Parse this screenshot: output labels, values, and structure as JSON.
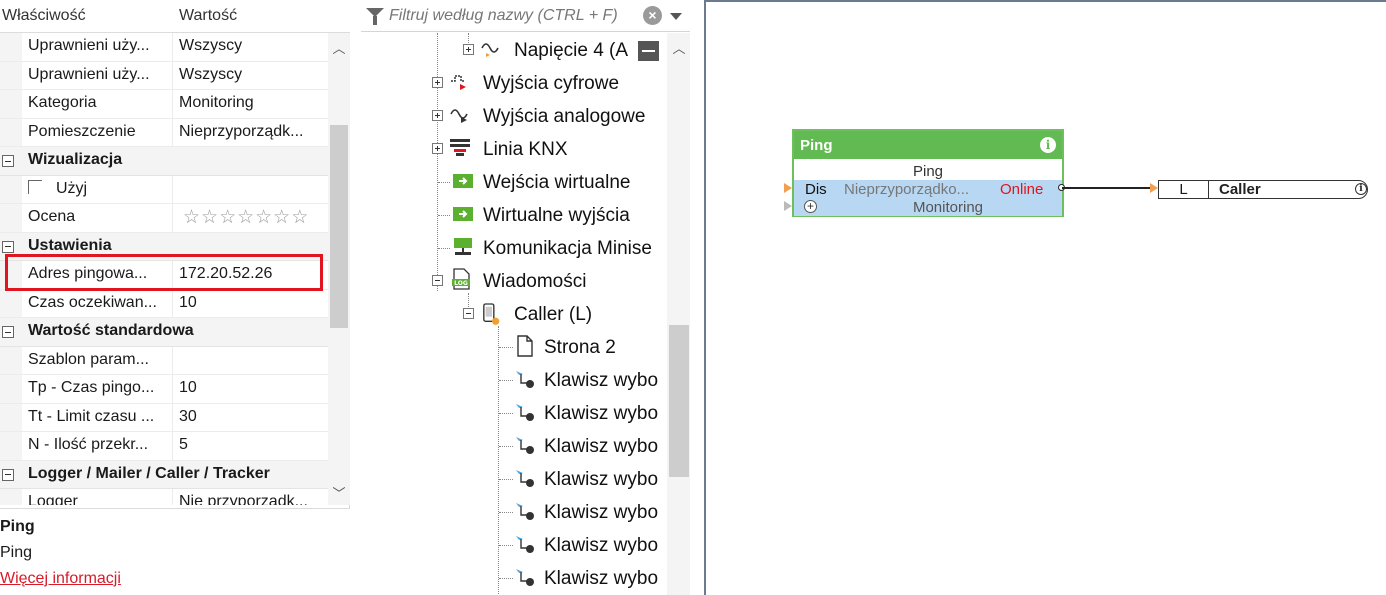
{
  "properties": {
    "header": {
      "col_name": "Właściwość",
      "col_value": "Wartość"
    },
    "rows": [
      {
        "name": "Uprawnieni uży...",
        "value": "Wszyscy"
      },
      {
        "name": "Uprawnieni uży...",
        "value": "Wszyscy"
      },
      {
        "name": "Kategoria",
        "value": "Monitoring"
      },
      {
        "name": "Pomieszczenie",
        "value": "Nieprzyporządk..."
      }
    ],
    "group_visualization": "Wizualizacja",
    "use_label": "Użyj",
    "rating_label": "Ocena",
    "rating_stars": "☆☆☆☆☆☆☆",
    "group_settings": "Ustawienia",
    "settings_rows": [
      {
        "name": "Adres pingowa...",
        "value": "172.20.52.26"
      },
      {
        "name": "Czas oczekiwan...",
        "value": "10"
      }
    ],
    "group_default": "Wartość standardowa",
    "default_rows": [
      {
        "name": "Szablon param...",
        "value": ""
      },
      {
        "name": "Tp - Czas pingo...",
        "value": "10"
      },
      {
        "name": "Tt - Limit czasu ...",
        "value": "30"
      },
      {
        "name": "N - Ilość przekr...",
        "value": "5"
      }
    ],
    "group_logger": "Logger / Mailer / Caller / Tracker",
    "logger_row": {
      "name": "Logger",
      "value": "Nie przyporządk..."
    },
    "info": {
      "title": "Ping",
      "subtitle": "Ping",
      "link": "Więcej informacji"
    }
  },
  "tree": {
    "filter_placeholder": "Filtruj według nazwy (CTRL + F)",
    "nodes": {
      "napiecie": "Napięcie 4 (A",
      "wyjscia_cyfrowe": "Wyjścia cyfrowe",
      "wyjscia_analogowe": "Wyjścia analogowe",
      "linia_knx": "Linia KNX",
      "wejscia_wirtualne": "Wejścia wirtualne",
      "wirtualne_wyjscia": "Wirtualne wyjścia",
      "komunikacja": "Komunikacja Minise",
      "wiadomosci": "Wiadomości",
      "caller": "Caller (L)",
      "strona": "Strona 2",
      "klawisz": "Klawisz wybo"
    }
  },
  "canvas": {
    "block": {
      "title": "Ping",
      "subtitle": "Ping",
      "input_label": "Dis",
      "input_value": "Nieprzyporządko...",
      "output_label": "Online",
      "monitoring": "Monitoring"
    },
    "caller_block": {
      "letter": "L",
      "name": "Caller"
    }
  },
  "colors": {
    "accent_green": "#62bb52",
    "highlight_red": "#e0151f",
    "row_blue": "#b8d7f2",
    "link_red": "#d81b2a"
  }
}
